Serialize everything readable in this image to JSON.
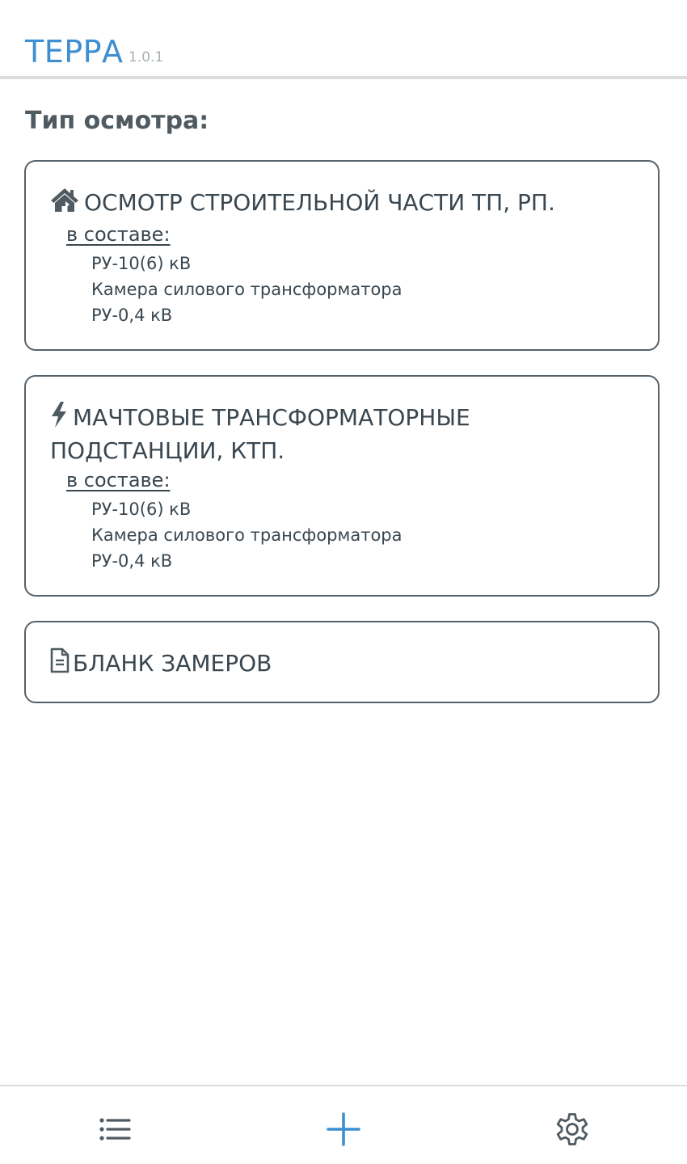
{
  "header": {
    "title": "ТЕРРА",
    "version": "1.0.1"
  },
  "section": {
    "title": "Тип осмотра:"
  },
  "cards": [
    {
      "icon": "house-icon",
      "title": "ОСМОТР СТРОИТЕЛЬНОЙ ЧАСТИ ТП, РП.",
      "composition_label": "в составе: ",
      "items": [
        "РУ-10(6) кВ",
        "Камера силового трансформатора",
        "РУ-0,4 кВ"
      ]
    },
    {
      "icon": "lightning-bolt-icon",
      "title": "МАЧТОВЫЕ ТРАНСФОРМАТОРНЫЕ ПОДСТАНЦИИ, КТП.",
      "composition_label": "в составе: ",
      "items": [
        "РУ-10(6) кВ",
        "Камера силового трансформатора",
        "РУ-0,4 кВ"
      ]
    },
    {
      "icon": "document-icon",
      "title": "БЛАНК ЗАМЕРОВ"
    }
  ],
  "bottom_nav": {
    "items": [
      {
        "icon": "list-icon"
      },
      {
        "icon": "plus-icon"
      },
      {
        "icon": "gear-icon"
      }
    ]
  },
  "colors": {
    "accent": "#3d8fd1",
    "text": "#3a4750",
    "border": "#56626b",
    "muted": "#a8b0b5"
  }
}
